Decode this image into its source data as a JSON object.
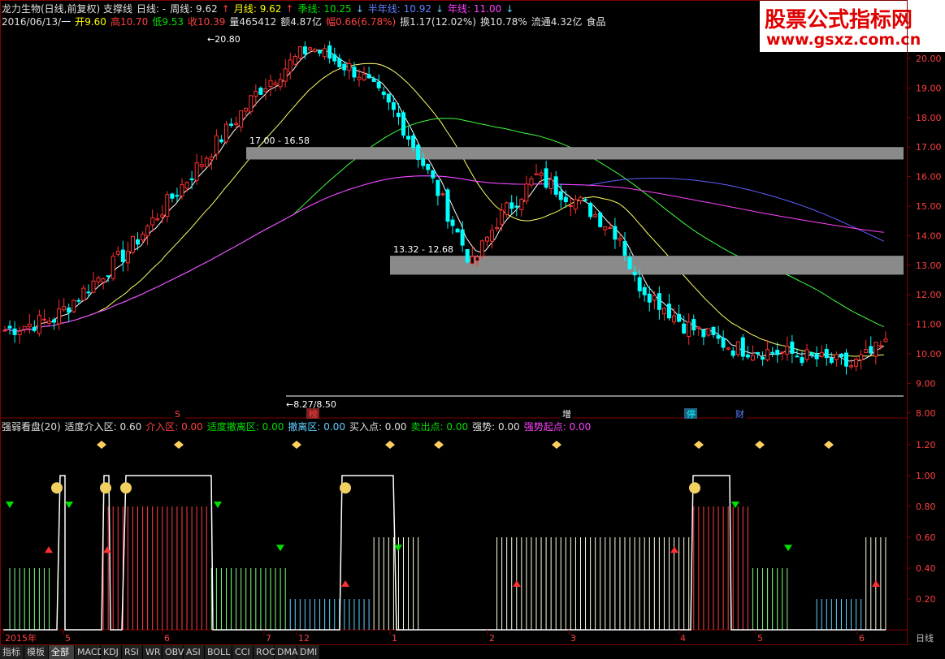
{
  "header": {
    "line1": [
      {
        "text": "龙力生物(日线,前复权) 支撑线",
        "color": "white"
      },
      {
        "text": "日线: -",
        "color": "white"
      },
      {
        "text": "周线: 9.62",
        "color": "white"
      },
      {
        "text": "↑",
        "color": "red"
      },
      {
        "text": "月线: 9.62",
        "color": "yellow"
      },
      {
        "text": "↑",
        "color": "red"
      },
      {
        "text": "季线: 10.25",
        "color": "green"
      },
      {
        "text": "↓",
        "color": "cyan"
      },
      {
        "text": "半年线: 10.92",
        "color": "blue"
      },
      {
        "text": "↓",
        "color": "cyan"
      },
      {
        "text": "年线: 11.00",
        "color": "magenta"
      },
      {
        "text": "↓",
        "color": "cyan"
      }
    ],
    "line2": [
      {
        "text": "2016/06/13/一",
        "color": "white"
      },
      {
        "text": "开9.60",
        "color": "yellow"
      },
      {
        "text": "高10.70",
        "color": "red"
      },
      {
        "text": "低9.53",
        "color": "green"
      },
      {
        "text": "收10.39",
        "color": "red"
      },
      {
        "text": "量465412",
        "color": "white"
      },
      {
        "text": "额4.87亿",
        "color": "white"
      },
      {
        "text": "幅0.66(6.78%)",
        "color": "red"
      },
      {
        "text": "振1.17(12.02%)",
        "color": "white"
      },
      {
        "text": "换10.78%",
        "color": "white"
      },
      {
        "text": "流通4.32亿",
        "color": "white"
      },
      {
        "text": "食品",
        "color": "white"
      }
    ],
    "indicator": [
      {
        "text": "强弱看盘(20)",
        "color": "white"
      },
      {
        "text": "适度介入区: 0.60",
        "color": "white"
      },
      {
        "text": "介入区: 0.00",
        "color": "red"
      },
      {
        "text": "适度撤离区: 0.00",
        "color": "green"
      },
      {
        "text": "撤离区: 0.00",
        "color": "cyan"
      },
      {
        "text": "买入点: 0.00",
        "color": "white"
      },
      {
        "text": "卖出点: 0.00",
        "color": "green"
      },
      {
        "text": "强势: 0.00",
        "color": "white"
      },
      {
        "text": "强势起点: 0.00",
        "color": "magenta"
      }
    ]
  },
  "logo": {
    "line1": "股票公式指标网",
    "line2": "www.gsxz.com.cn"
  },
  "colors": {
    "up": "#ff3030",
    "down": "#00ffff",
    "ma5": "#ffffff",
    "ma20": "#ffff66",
    "ma60": "#40ff40",
    "ma120": "#6060ff",
    "ma250": "#ff40ff",
    "band": "#8a8a8a"
  },
  "chart_data": {
    "type": "candlestick",
    "price_axis": {
      "ticks": [
        "20.00",
        "19.00",
        "18.00",
        "17.00",
        "16.00",
        "15.00",
        "14.00",
        "13.00",
        "12.00",
        "11.00",
        "10.00",
        "9.00",
        "8.00"
      ],
      "min": 7.8,
      "max": 20.3
    },
    "indicator_axis": {
      "ticks": [
        "1.20",
        "1.00",
        "0.80",
        "0.60",
        "0.40",
        "0.20"
      ]
    },
    "support_bands": [
      {
        "label": "17.00 - 16.58",
        "high": 17.0,
        "low": 16.58
      },
      {
        "label": "13.32 - 12.68",
        "high": 13.32,
        "low": 12.68
      }
    ],
    "annotations": [
      {
        "label": "20.80",
        "price": 20.8
      },
      {
        "label": "8.27/8.50",
        "price": 8.4
      }
    ],
    "event_markers": [
      "S",
      "榜",
      "增",
      "停",
      "财"
    ],
    "x_labels": [
      "2015年",
      "5",
      "6",
      "7",
      "12",
      "1",
      "2",
      "3",
      "4",
      "5",
      "6"
    ],
    "right_label": "日线"
  },
  "toolbar": {
    "items": [
      "指标",
      "模板",
      "全部",
      "MACD",
      "KDJ",
      "RSI",
      "WR",
      "OBV",
      "ASI",
      "BOLL",
      "CCI",
      "ROC",
      "DMA",
      "DMI"
    ],
    "active": "全部"
  }
}
